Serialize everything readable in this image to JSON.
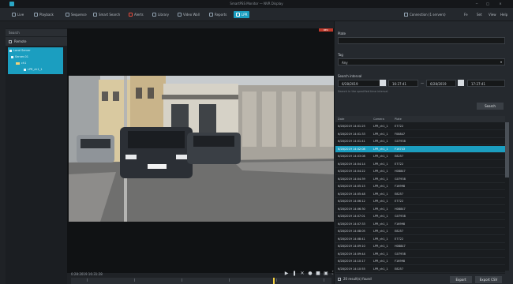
{
  "titlebar": {
    "title": "SmartPSS Monitor — NVR Display",
    "controls": [
      "−",
      "□",
      "×"
    ]
  },
  "toolbar": {
    "items": [
      {
        "label": "Live",
        "icon": "live-icon"
      },
      {
        "label": "Playback",
        "icon": "playback-icon"
      },
      {
        "label": "Sequence",
        "icon": "sequence-icon"
      },
      {
        "label": "Smart Search",
        "icon": "smart-search-icon"
      },
      {
        "label": "Alerts",
        "icon": "alerts-icon"
      },
      {
        "label": "Library",
        "icon": "library-icon"
      },
      {
        "label": "Video Wall",
        "icon": "video-wall-icon"
      },
      {
        "label": "Reports",
        "icon": "reports-icon"
      },
      {
        "label": "LPR",
        "icon": "lpr-icon",
        "active": true
      }
    ],
    "right": [
      "Connection (1 servers)",
      "Fe",
      "Set",
      "View",
      "Help"
    ]
  },
  "left": {
    "search_label": "Search",
    "remote_label": "Remote",
    "tree": [
      "Local Server",
      "Server-01",
      "ch1",
      "LPR_ch1_1"
    ]
  },
  "video": {
    "rec_label": "REC",
    "time_label": "0:28:2019 16:31:28"
  },
  "right": {
    "plate_label": "Plate",
    "plate_value": "",
    "tag_label": "Tag",
    "tag_value": "Any",
    "interval_label": "Search interval",
    "date_from": "6/28/2019",
    "time_from": "16:27:41",
    "date_to": "6/28/2019",
    "time_to": "17:27:41",
    "hint": "Search in the specified time interval",
    "search_button": "Search",
    "columns": [
      "Date",
      "Camera",
      "Plate"
    ],
    "rows": [
      [
        "6/28/2019 14:01:25",
        "LPR_ch1_1",
        "E7722"
      ],
      [
        "6/28/2019 14:01:33",
        "LPR_ch1_1",
        "F08847"
      ],
      [
        "6/28/2019 14:01:41",
        "LPR_ch1_1",
        "G07938"
      ],
      [
        "6/28/2019 14:02:08",
        "LPR_ch1_1",
        "F16743"
      ],
      [
        "6/28/2019 14:03:08",
        "LPR_ch1_1",
        "E8257"
      ],
      [
        "6/28/2019 14:04:14",
        "LPR_ch1_1",
        "E7722"
      ],
      [
        "6/28/2019 14:04:22",
        "LPR_ch1_1",
        "H08847"
      ],
      [
        "6/28/2019 14:04:39",
        "LPR_ch1_1",
        "G07938"
      ],
      [
        "6/28/2019 14:05:15",
        "LPR_ch1_1",
        "F16998"
      ],
      [
        "6/28/2019 14:05:48",
        "LPR_ch1_1",
        "E8257"
      ],
      [
        "6/28/2019 14:06:12",
        "LPR_ch1_1",
        "E7722"
      ],
      [
        "6/28/2019 14:06:30",
        "LPR_ch1_1",
        "H08847"
      ],
      [
        "6/28/2019 14:07:01",
        "LPR_ch1_1",
        "G07938"
      ],
      [
        "6/28/2019 14:07:33",
        "LPR_ch1_1",
        "F16998"
      ],
      [
        "6/28/2019 14:08:05",
        "LPR_ch1_1",
        "E8257"
      ],
      [
        "6/28/2019 14:08:41",
        "LPR_ch1_1",
        "E7722"
      ],
      [
        "6/28/2019 14:09:10",
        "LPR_ch1_1",
        "H08847"
      ],
      [
        "6/28/2019 14:09:44",
        "LPR_ch1_1",
        "G07938"
      ],
      [
        "6/28/2019 14:10:17",
        "LPR_ch1_1",
        "F16998"
      ],
      [
        "6/28/2019 14:10:55",
        "LPR_ch1_1",
        "E8257"
      ]
    ],
    "selected_row": 3,
    "results_count": "20 result(s) found",
    "export_button": "Export",
    "export_csv_button": "Export CSV"
  }
}
